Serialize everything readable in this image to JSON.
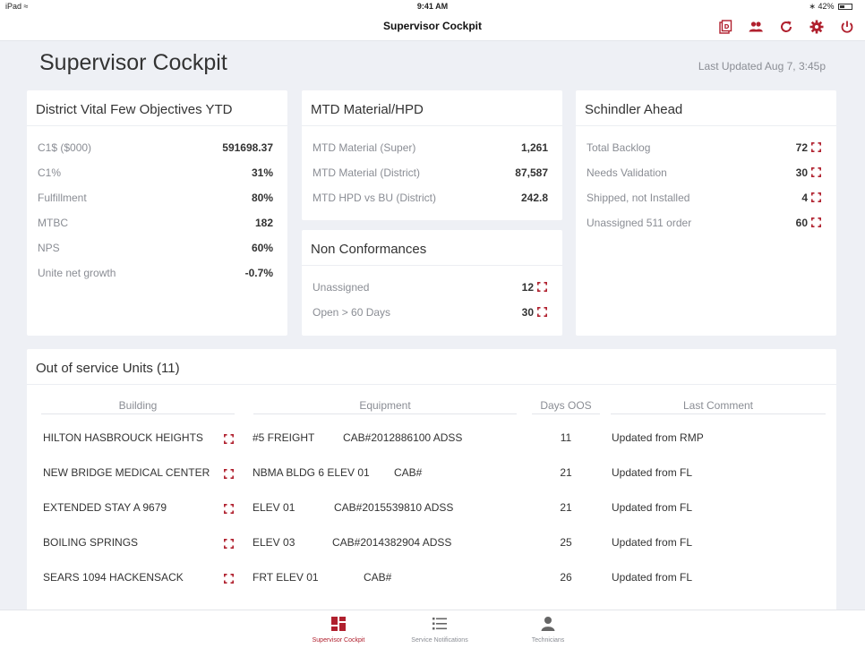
{
  "status_bar": {
    "device": "iPad",
    "time": "9:41 AM",
    "battery": "42%",
    "battery_level": 0.42
  },
  "nav": {
    "title": "Supervisor Cockpit",
    "icons": [
      "report-icon",
      "team-icon",
      "refresh-icon",
      "settings-icon",
      "power-icon"
    ]
  },
  "page": {
    "title": "Supervisor Cockpit",
    "last_updated": "Last Updated Aug 7, 3:45p"
  },
  "district": {
    "title": "District Vital Few Objectives YTD",
    "rows": [
      {
        "label": "C1$  ($000)",
        "value": "591698.37"
      },
      {
        "label": "C1%",
        "value": "31%"
      },
      {
        "label": "Fulfillment",
        "value": "80%"
      },
      {
        "label": "MTBC",
        "value": "182"
      },
      {
        "label": "NPS",
        "value": "60%"
      },
      {
        "label": "Unite net growth",
        "value": "-0.7%"
      }
    ]
  },
  "mtd": {
    "title": "MTD Material/HPD",
    "rows": [
      {
        "label": "MTD Material (Super)",
        "value": "1,261"
      },
      {
        "label": "MTD Material (District)",
        "value": "87,587"
      },
      {
        "label": "MTD HPD vs BU (District)",
        "value": "242.8"
      }
    ]
  },
  "nonconf": {
    "title": "Non Conformances",
    "rows": [
      {
        "label": "Unassigned",
        "value": "12"
      },
      {
        "label": "Open > 60 Days",
        "value": "30"
      }
    ]
  },
  "ahead": {
    "title": "Schindler Ahead",
    "rows": [
      {
        "label": "Total Backlog",
        "value": "72"
      },
      {
        "label": "Needs Validation",
        "value": "30"
      },
      {
        "label": "Shipped, not Installed",
        "value": "4"
      },
      {
        "label": "Unassigned 511 order",
        "value": "60"
      }
    ]
  },
  "oos": {
    "title": "Out of service Units (11)",
    "columns": {
      "building": "Building",
      "equipment": "Equipment",
      "days": "Days OOS",
      "comment": "Last Comment"
    },
    "rows": [
      {
        "building": "HILTON HASBROUCK HEIGHTS",
        "equip_name": "#5 FREIGHT",
        "equip_cab": "CAB#2012886100   ADSS",
        "days": "11",
        "comment": "Updated from RMP"
      },
      {
        "building": "NEW BRIDGE MEDICAL CENTER",
        "equip_name": "NBMA BLDG 6 ELEV 01",
        "equip_cab": "CAB#",
        "days": "21",
        "comment": "Updated from FL"
      },
      {
        "building": "EXTENDED STAY A 9679",
        "equip_name": "ELEV 01",
        "equip_cab": "CAB#2015539810   ADSS",
        "days": "21",
        "comment": "Updated from FL"
      },
      {
        "building": "BOILING SPRINGS",
        "equip_name": "ELEV 03",
        "equip_cab": "CAB#2014382904   ADSS",
        "days": "25",
        "comment": "Updated from FL"
      },
      {
        "building": "SEARS 1094 HACKENSACK",
        "equip_name": "FRT ELEV 01",
        "equip_cab": "CAB#",
        "days": "26",
        "comment": "Updated from FL"
      }
    ]
  },
  "tabs": [
    {
      "label": "Supervisor Cockpit",
      "icon": "dashboard-icon",
      "active": true
    },
    {
      "label": "Service Notifications",
      "icon": "list-icon",
      "active": false
    },
    {
      "label": "Technicians",
      "icon": "person-icon",
      "active": false
    }
  ],
  "colors": {
    "accent": "#b0202e",
    "background": "#eef0f5",
    "muted": "#8a8d94"
  }
}
